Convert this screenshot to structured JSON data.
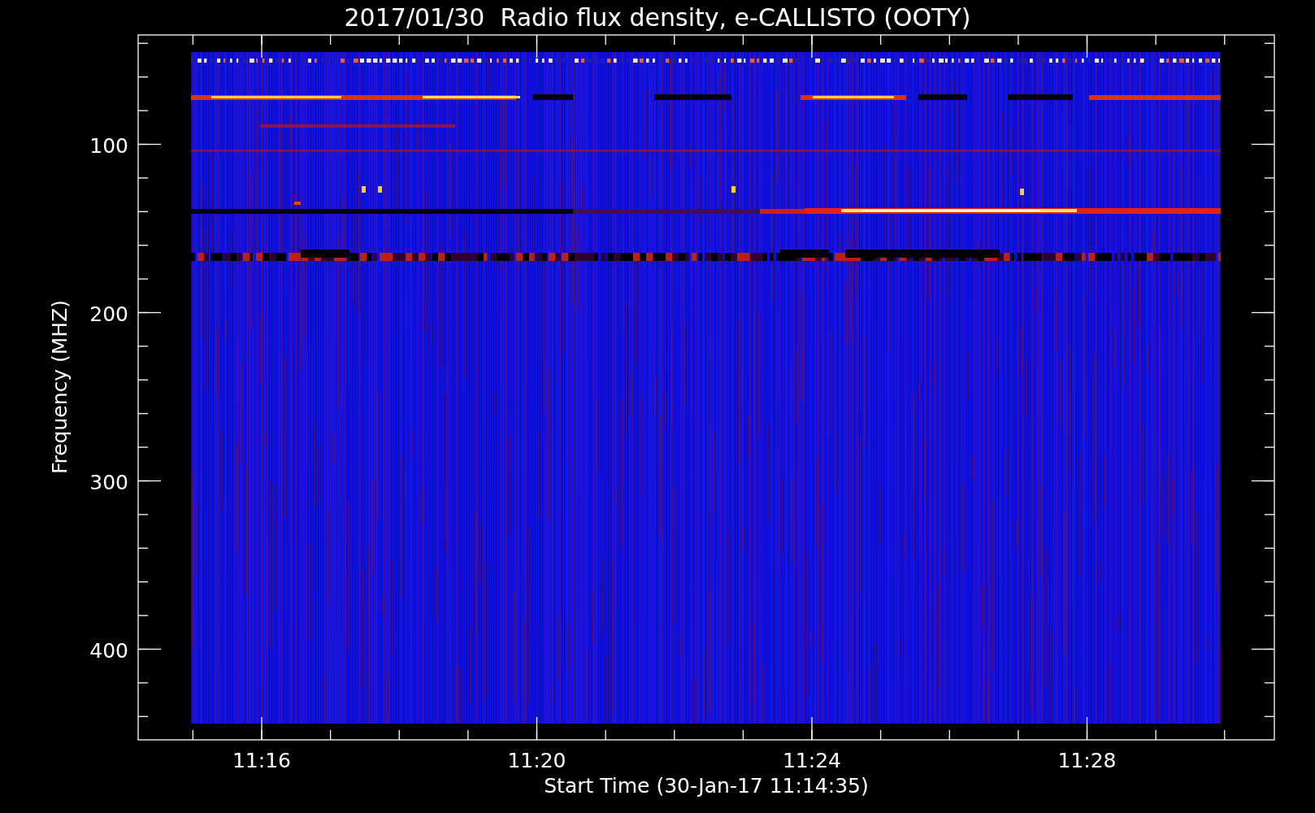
{
  "title": "2017/01/30  Radio flux density, e-CALLISTO (OOTY)",
  "y_axis": {
    "label": "Frequency (MHZ)",
    "ticks": [
      "100",
      "200",
      "300",
      "400"
    ]
  },
  "x_axis": {
    "label": "Start Time (30-Jan-17 11:14:35)",
    "ticks": [
      "11:16",
      "11:20",
      "11:24",
      "11:28"
    ]
  }
}
